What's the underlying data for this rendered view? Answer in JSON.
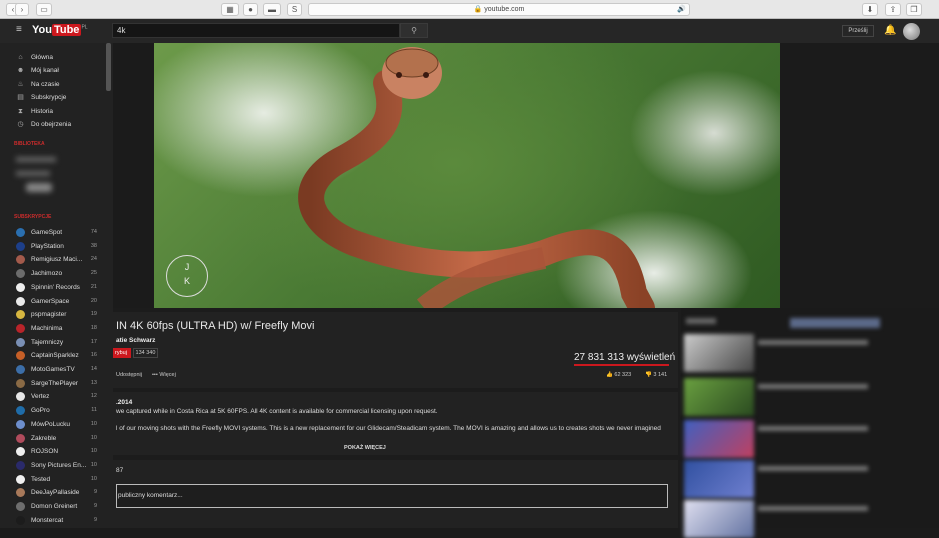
{
  "browser": {
    "url": "youtube.com",
    "tab_grid_icon": "grid-icon",
    "buttons": [
      "back",
      "forward",
      "sidebar",
      "privacy",
      "extension",
      "script"
    ]
  },
  "header": {
    "logo_you": "You",
    "logo_tube": "Tube",
    "logo_region": "PL",
    "search_value": "4k",
    "upload_label": "Prześlij"
  },
  "sidebar": {
    "nav": [
      {
        "icon": "home-icon",
        "label": "Główna"
      },
      {
        "icon": "person-icon",
        "label": "Mój kanał"
      },
      {
        "icon": "fire-icon",
        "label": "Na czasie"
      },
      {
        "icon": "subscriptions-icon",
        "label": "Subskrypcje"
      },
      {
        "icon": "history-icon",
        "label": "Historia"
      },
      {
        "icon": "clock-icon",
        "label": "Do obejrzenia"
      }
    ],
    "library_heading": "BIBLIOTEKA",
    "subscriptions_heading": "SUBSKRYPCJE",
    "subscriptions": [
      {
        "label": "GameSpot",
        "count": "74",
        "color": "#2a6fb0"
      },
      {
        "label": "PlayStation",
        "count": "38",
        "color": "#1d3f8a"
      },
      {
        "label": "Remigiusz Maci...",
        "count": "24",
        "color": "#a35a4b"
      },
      {
        "label": "Jachimozo",
        "count": "25",
        "color": "#6c6c6c"
      },
      {
        "label": "Spinnin' Records",
        "count": "21",
        "color": "#eeeeee"
      },
      {
        "label": "GamerSpace",
        "count": "20",
        "color": "#e9e9e9"
      },
      {
        "label": "pspmagister",
        "count": "19",
        "color": "#d6b640"
      },
      {
        "label": "Machinima",
        "count": "18",
        "color": "#b8242a"
      },
      {
        "label": "Tajemniczy",
        "count": "17",
        "color": "#7a8fb4"
      },
      {
        "label": "CaptainSparklez",
        "count": "16",
        "color": "#c65f27"
      },
      {
        "label": "MotoGamesTV",
        "count": "14",
        "color": "#3c6ea8"
      },
      {
        "label": "SargeThePlayer",
        "count": "13",
        "color": "#8a6a45"
      },
      {
        "label": "Vertez",
        "count": "12",
        "color": "#e6e6e6"
      },
      {
        "label": "GoPro",
        "count": "11",
        "color": "#1f6ca8"
      },
      {
        "label": "MówPoLucku",
        "count": "10",
        "color": "#6d8ecc"
      },
      {
        "label": "Zakreble",
        "count": "10",
        "color": "#b04b5c"
      },
      {
        "label": "ROJSON",
        "count": "10",
        "color": "#eeeeee"
      },
      {
        "label": "Sony Pictures En...",
        "count": "10",
        "color": "#2a2a6a"
      },
      {
        "label": "Tested",
        "count": "10",
        "color": "#f0f0f0"
      },
      {
        "label": "DeeJayPallaside",
        "count": "9",
        "color": "#a8795a"
      },
      {
        "label": "Domon Greinert",
        "count": "9",
        "color": "#6e6e6e"
      },
      {
        "label": "Monstercat",
        "count": "9",
        "color": "#1c1c1c"
      }
    ]
  },
  "video": {
    "watermark_top": "J",
    "watermark_bottom": "K",
    "title": "IN 4K 60fps (ULTRA HD) w/ Freefly Movi",
    "channel": "atie Schwarz",
    "subscribe_label": "rybuj",
    "subscriber_count": "134 340",
    "views": "27 831 313 wyświetleń",
    "share_label": "Udostępnij",
    "more_label": "Więcej",
    "likes": "62 323",
    "dislikes": "3 141"
  },
  "description": {
    "date": ".2014",
    "line1": "we captured while in Costa Rica at 5K 60FPS. All 4K content is available for commercial licensing upon request.",
    "line2": "l of our moving shots with the Freefly MOVI systems. This is a new replacement for our Glidecam/Steadicam system. The MOVI is amazing and allows us to creates shots we never imagined",
    "show_more": "POKAŻ WIĘCEJ"
  },
  "comments": {
    "count": "87",
    "input_placeholder": "publiczny komentarz..."
  }
}
